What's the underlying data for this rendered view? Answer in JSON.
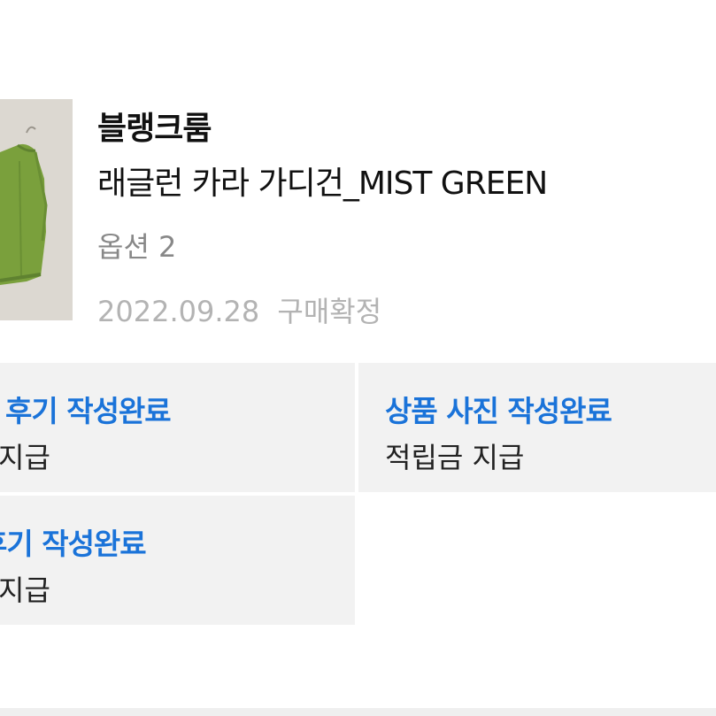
{
  "product": {
    "brand": "블랭크룸",
    "name": "래글런 카라 가디건_MIST GREEN",
    "option": "옵션 2",
    "date": "2022.09.28",
    "status": "구매확정"
  },
  "reviews": [
    {
      "title": "후기 작성완료",
      "reward": "지급"
    },
    {
      "title": "상품 사진 작성완료",
      "reward": "적립금 지급"
    },
    {
      "title": "후기 작성완료",
      "reward": "지급"
    }
  ],
  "colors": {
    "accent": "#1a73d9",
    "cell_bg": "#f2f2f2",
    "muted": "#888888",
    "product": "#7aa03c"
  },
  "icons": {
    "thumbnail": "green-cardigan-image"
  }
}
